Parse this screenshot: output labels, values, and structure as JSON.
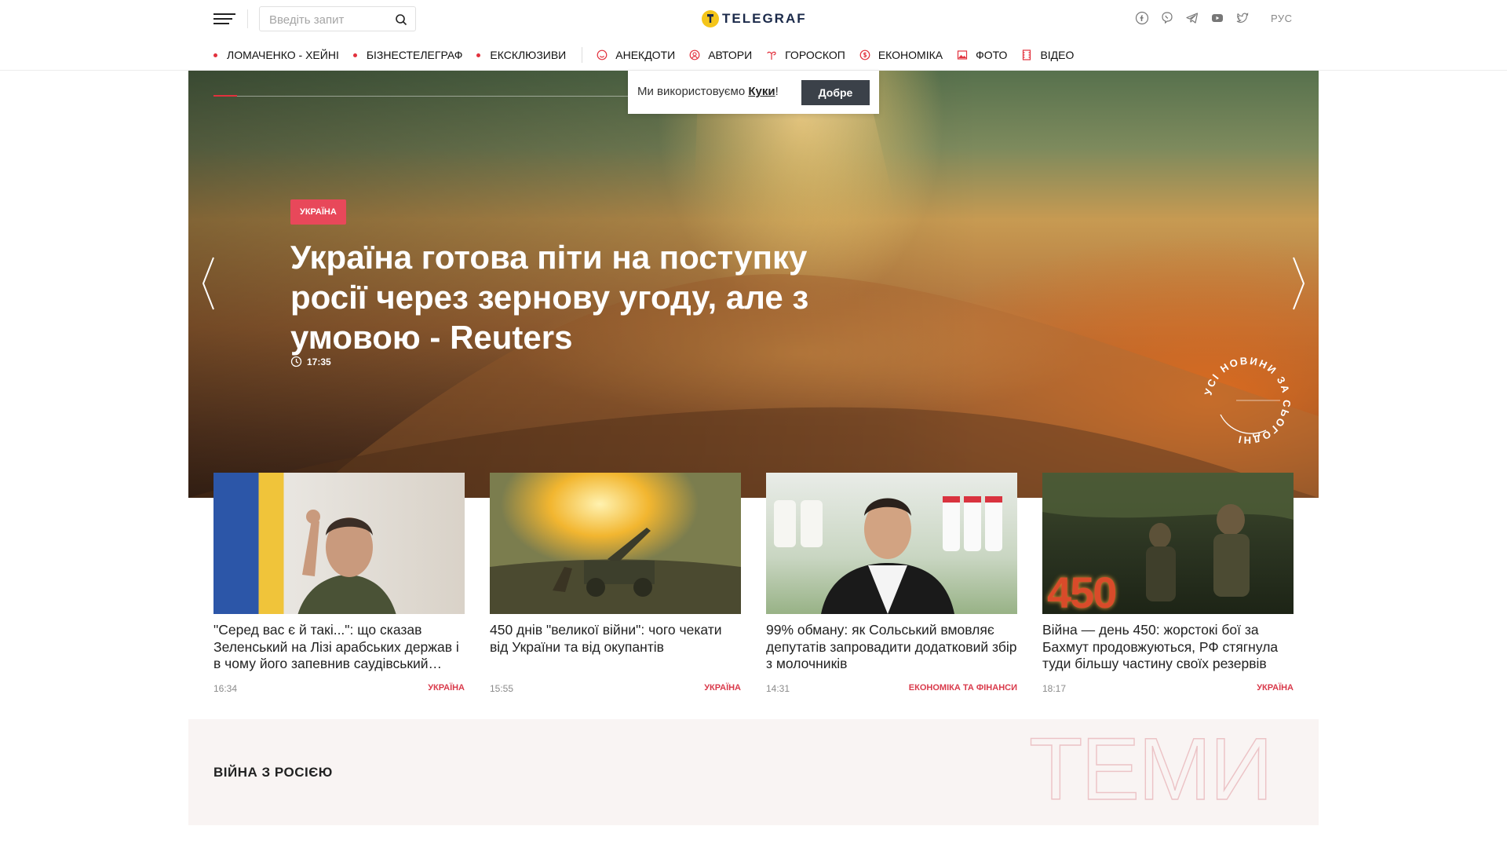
{
  "header": {
    "search_placeholder": "Введіть запит",
    "logo_text": "TELEGRAF",
    "language": "РУС",
    "social": [
      "facebook-icon",
      "viber-icon",
      "telegram-icon",
      "youtube-icon",
      "twitter-icon"
    ]
  },
  "nav": {
    "hot": [
      "ЛОМАЧЕНКО - ХЕЙНІ",
      "БІЗНЕСТЕЛЕГРАФ",
      "ЕКСКЛЮЗИВИ"
    ],
    "sections": [
      {
        "label": "АНЕКДОТИ",
        "icon": "smile-icon"
      },
      {
        "label": "АВТОРИ",
        "icon": "author-icon"
      },
      {
        "label": "ГОРОСКОП",
        "icon": "zodiac-icon"
      },
      {
        "label": "ЕКОНОМІКА",
        "icon": "dollar-icon"
      },
      {
        "label": "ФОТО",
        "icon": "photo-icon"
      },
      {
        "label": "ВІДЕО",
        "icon": "video-icon"
      }
    ]
  },
  "cookie": {
    "text": "Ми використовуємо ",
    "link": "Куки",
    "suffix": "!",
    "button": "Добре"
  },
  "hero": {
    "tag": "УКРАЇНА",
    "title": "Україна готова піти на поступку росії через зернову угоду, але з умовою - Reuters",
    "time": "17:35",
    "round_link": "УСІ НОВИНИ ЗА СЬОГОДНІ"
  },
  "cards": [
    {
      "title": "\"Серед вас є й такі...\": що сказав Зеленський на Лізі арабських держав і в чому його запевнив саудівський принц",
      "time": "16:34",
      "category": "УКРАЇНА"
    },
    {
      "title": "450 днів \"великої війни\": чого чекати від України та від окупантів",
      "time": "15:55",
      "category": "УКРАЇНА"
    },
    {
      "title": "99% обману: як Сольський вмовляє депутатів запровадити додатковий збір з молочників",
      "time": "14:31",
      "category": "ЕКОНОМІКА ТА ФІНАНСИ"
    },
    {
      "title": "Війна — день 450: жорстокі бої за Бахмут продовжуються, РФ стягнула туди більшу частину своїх резервів",
      "time": "18:17",
      "category": "УКРАЇНА"
    }
  ],
  "card_image_text": {
    "number": "450"
  },
  "topics": {
    "title": "ВІЙНА З РОСІЄЮ",
    "watermark": "ТЕМИ"
  },
  "colors": {
    "accent": "#e2313d",
    "tag_bg": "#e8485a",
    "category": "#d93a4b",
    "button": "#3b4149"
  }
}
